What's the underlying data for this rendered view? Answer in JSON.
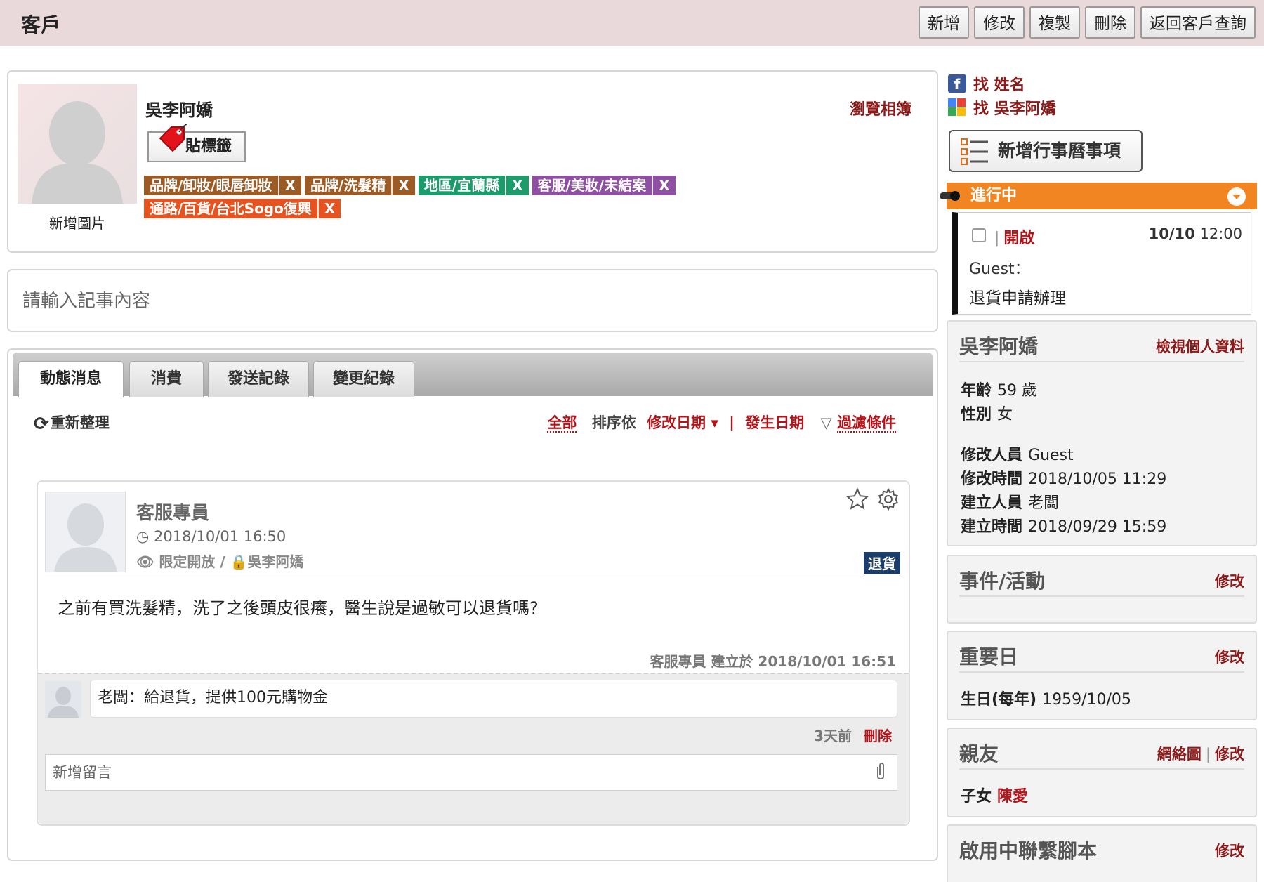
{
  "header": {
    "title": "客戶",
    "buttons": [
      "新增",
      "修改",
      "複製",
      "刪除",
      "返回客戶查詢"
    ]
  },
  "profile": {
    "name": "吳李阿嬌",
    "add_image": "新增圖片",
    "album_link": "瀏覽相簿",
    "tag_button": "貼標籤",
    "tags": [
      {
        "label": "品牌/卸妝/眼唇卸妝",
        "x": "X",
        "color": "#9c5b24"
      },
      {
        "label": "品牌/洗髮精",
        "x": "X",
        "color": "#9c5b24"
      },
      {
        "label": "地區/宜蘭縣",
        "x": "X",
        "color": "#1c9b6b"
      },
      {
        "label": "客服/美妝/未結案",
        "x": "X",
        "color": "#8f4fa3"
      },
      {
        "label": "通路/百貨/台北Sogo復興",
        "x": "X",
        "color": "#e8521e"
      }
    ]
  },
  "note": {
    "placeholder": "請輸入記事內容"
  },
  "activity": {
    "tabs": [
      "動態消息",
      "消費",
      "發送記錄",
      "變更紀錄"
    ],
    "refresh": "重新整理",
    "sort": {
      "all": "全部",
      "sort_by": "排序依",
      "modified": "修改日期",
      "occurred": "發生日期",
      "filter": "過濾條件"
    },
    "post": {
      "author": "客服專員",
      "time": "2018/10/01 16:50",
      "visibility": "限定開放",
      "owner": "吳李阿嬌",
      "badge": "退貨",
      "body": "之前有買洗髮精，洗了之後頭皮很癢，醫生說是過敏可以退貨嗎?",
      "meta": "客服專員 建立於 2018/10/01 16:51",
      "comment": {
        "text": "老闆：給退貨，提供100元購物金",
        "ago": "3天前",
        "delete": "刪除"
      },
      "comment_placeholder": "新增留言"
    }
  },
  "sidebar": {
    "social": {
      "facebook": "找 姓名",
      "google": "找 吳李阿嬌"
    },
    "add_event": "新增行事曆事項",
    "in_progress": {
      "title": "進行中",
      "task": {
        "status": "開啟",
        "date": "10/10",
        "time": "12:00",
        "guest": "Guest：",
        "title": "退貨申請辦理"
      }
    },
    "person": {
      "name": "吳李阿嬌",
      "link": "檢視個人資料",
      "age_label": "年齡",
      "age_value": "59 歲",
      "gender_label": "性別",
      "gender_value": "女",
      "modifier_label": "修改人員",
      "modifier_value": "Guest",
      "modified_time_label": "修改時間",
      "modified_time_value": "2018/10/05 11:29",
      "creator_label": "建立人員",
      "creator_value": "老闆",
      "created_time_label": "建立時間",
      "created_time_value": "2018/09/29 15:59"
    },
    "events": {
      "title": "事件/活動",
      "link": "修改"
    },
    "important_dates": {
      "title": "重要日",
      "link": "修改",
      "birthday_label": "生日(每年)",
      "birthday_value": "1959/10/05"
    },
    "relatives": {
      "title": "親友",
      "link_network": "網絡圖",
      "link": "修改",
      "relation_label": "子女",
      "relation_value": "陳愛"
    },
    "scripts": {
      "title": "啟用中聯繫腳本",
      "link": "修改"
    }
  }
}
